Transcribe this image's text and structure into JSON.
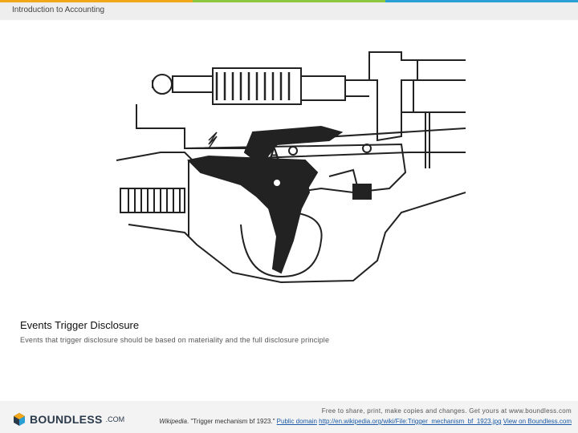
{
  "accent_colors": [
    "#f2a71b",
    "#8dc63f",
    "#2a9fd6",
    "#7fb539"
  ],
  "header": {
    "title": "Introduction to Accounting"
  },
  "figure": {
    "letter": "A",
    "image_name": "trigger-mechanism-drawing"
  },
  "caption": {
    "title": "Events Trigger Disclosure",
    "text": "Events that trigger disclosure should be based on materiality and the full disclosure principle"
  },
  "footer": {
    "logo_word": "BOUNDLESS",
    "logo_domain": ".COM",
    "share_text": "Free to share, print, make copies and changes. Get yours at www.boundless.com",
    "attribution_source": "Wikipedia",
    "attribution_title": ". \"Trigger mechanism bf 1923.\"",
    "license_link": "Public domain",
    "file_link": "http://en.wikipedia.org/wiki/File:Trigger_mechanism_bf_1923.jpg",
    "view_link": "View on Boundless.com"
  }
}
